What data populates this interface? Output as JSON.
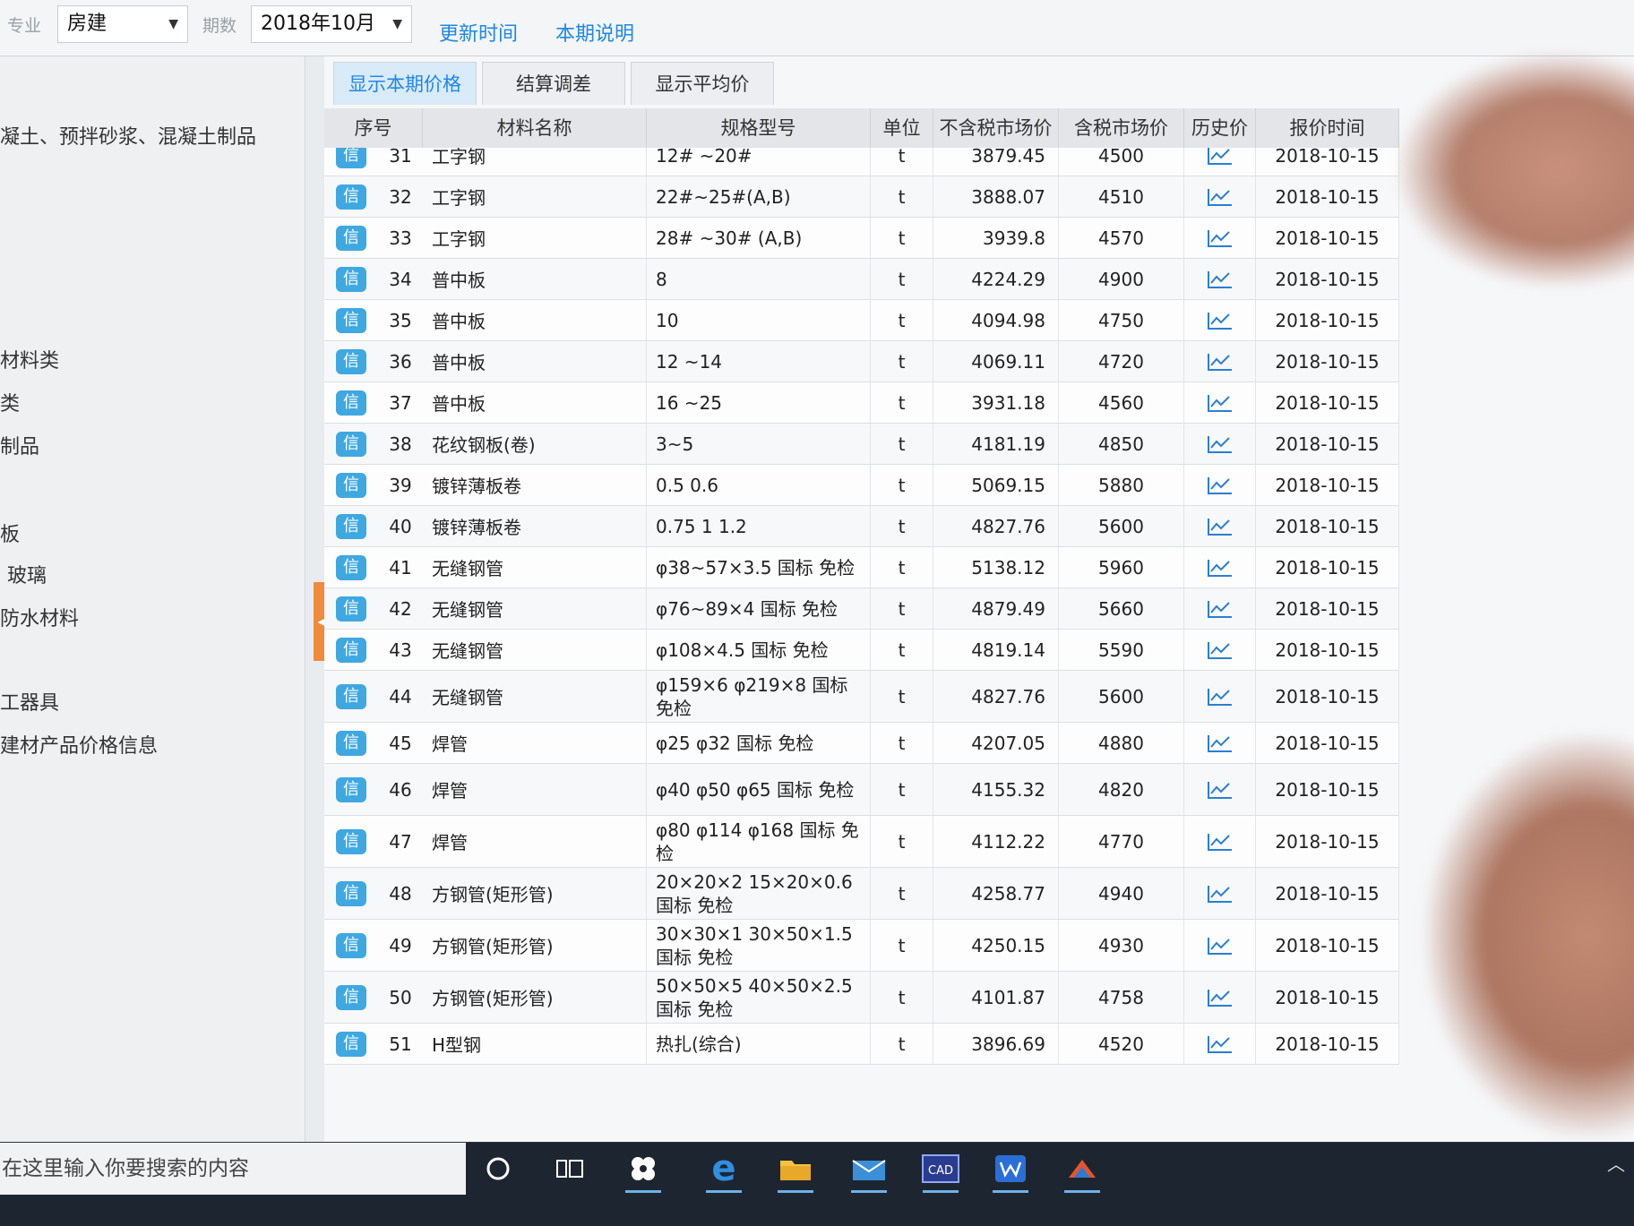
{
  "topbar": {
    "specialty_label": "专业",
    "specialty_value": "房建",
    "period_label": "期数",
    "period_value": "2018年10月",
    "update_time_link": "更新时间",
    "period_note_link": "本期说明"
  },
  "sidebar": {
    "items": [
      {
        "label": "凝土、预拌砂浆、混凝土制品"
      },
      {
        "label": "材料类"
      },
      {
        "label": "类"
      },
      {
        "label": "制品"
      },
      {
        "label": "板"
      },
      {
        "label": "玻璃"
      },
      {
        "label": "防水材料"
      },
      {
        "label": "工器具"
      },
      {
        "label": "建材产品价格信息"
      }
    ]
  },
  "tabs": [
    {
      "label": "显示本期价格"
    },
    {
      "label": "结算调差"
    },
    {
      "label": "显示平均价"
    }
  ],
  "table": {
    "columns": [
      "序号",
      "材料名称",
      "规格型号",
      "单位",
      "不含税市场价",
      "含税市场价",
      "历史价",
      "报价时间"
    ],
    "info_badge": "信",
    "rows": [
      {
        "no": "31",
        "name": "工字钢",
        "spec": "12# ~20#",
        "unit": "t",
        "price_ex": "3879.45",
        "price_in": "4500",
        "date": "2018-10-15"
      },
      {
        "no": "32",
        "name": "工字钢",
        "spec": "22#~25#(A,B)",
        "unit": "t",
        "price_ex": "3888.07",
        "price_in": "4510",
        "date": "2018-10-15"
      },
      {
        "no": "33",
        "name": "工字钢",
        "spec": "28# ~30# (A,B)",
        "unit": "t",
        "price_ex": "3939.8",
        "price_in": "4570",
        "date": "2018-10-15"
      },
      {
        "no": "34",
        "name": "普中板",
        "spec": "8",
        "unit": "t",
        "price_ex": "4224.29",
        "price_in": "4900",
        "date": "2018-10-15"
      },
      {
        "no": "35",
        "name": "普中板",
        "spec": "10",
        "unit": "t",
        "price_ex": "4094.98",
        "price_in": "4750",
        "date": "2018-10-15"
      },
      {
        "no": "36",
        "name": "普中板",
        "spec": "12 ~14",
        "unit": "t",
        "price_ex": "4069.11",
        "price_in": "4720",
        "date": "2018-10-15"
      },
      {
        "no": "37",
        "name": "普中板",
        "spec": "16 ~25",
        "unit": "t",
        "price_ex": "3931.18",
        "price_in": "4560",
        "date": "2018-10-15"
      },
      {
        "no": "38",
        "name": "花纹钢板(卷)",
        "spec": "3~5",
        "unit": "t",
        "price_ex": "4181.19",
        "price_in": "4850",
        "date": "2018-10-15"
      },
      {
        "no": "39",
        "name": "镀锌薄板卷",
        "spec": "0.5 0.6",
        "unit": "t",
        "price_ex": "5069.15",
        "price_in": "5880",
        "date": "2018-10-15"
      },
      {
        "no": "40",
        "name": "镀锌薄板卷",
        "spec": "0.75 1 1.2",
        "unit": "t",
        "price_ex": "4827.76",
        "price_in": "5600",
        "date": "2018-10-15"
      },
      {
        "no": "41",
        "name": "无缝钢管",
        "spec": "φ38~57×3.5 国标 免检",
        "unit": "t",
        "price_ex": "5138.12",
        "price_in": "5960",
        "date": "2018-10-15"
      },
      {
        "no": "42",
        "name": "无缝钢管",
        "spec": "φ76~89×4 国标 免检",
        "unit": "t",
        "price_ex": "4879.49",
        "price_in": "5660",
        "date": "2018-10-15"
      },
      {
        "no": "43",
        "name": "无缝钢管",
        "spec": "φ108×4.5 国标 免检",
        "unit": "t",
        "price_ex": "4819.14",
        "price_in": "5590",
        "date": "2018-10-15"
      },
      {
        "no": "44",
        "name": "无缝钢管",
        "spec": "φ159×6 φ219×8 国标 免检",
        "unit": "t",
        "price_ex": "4827.76",
        "price_in": "5600",
        "date": "2018-10-15"
      },
      {
        "no": "45",
        "name": "焊管",
        "spec": "φ25 φ32 国标 免检",
        "unit": "t",
        "price_ex": "4207.05",
        "price_in": "4880",
        "date": "2018-10-15"
      },
      {
        "no": "46",
        "name": "焊管",
        "spec": "φ40 φ50 φ65 国标 免检",
        "unit": "t",
        "price_ex": "4155.32",
        "price_in": "4820",
        "date": "2018-10-15"
      },
      {
        "no": "47",
        "name": "焊管",
        "spec": "φ80 φ114 φ168 国标 免检",
        "unit": "t",
        "price_ex": "4112.22",
        "price_in": "4770",
        "date": "2018-10-15"
      },
      {
        "no": "48",
        "name": "方钢管(矩形管)",
        "spec": "20×20×2 15×20×0.6 国标 免检",
        "unit": "t",
        "price_ex": "4258.77",
        "price_in": "4940",
        "date": "2018-10-15"
      },
      {
        "no": "49",
        "name": "方钢管(矩形管)",
        "spec": "30×30×1 30×50×1.5 国标 免检",
        "unit": "t",
        "price_ex": "4250.15",
        "price_in": "4930",
        "date": "2018-10-15"
      },
      {
        "no": "50",
        "name": "方钢管(矩形管)",
        "spec": "50×50×5 40×50×2.5 国标 免检",
        "unit": "t",
        "price_ex": "4101.87",
        "price_in": "4758",
        "date": "2018-10-15"
      },
      {
        "no": "51",
        "name": "H型钢",
        "spec": "热扎(综合)",
        "unit": "t",
        "price_ex": "3896.69",
        "price_in": "4520",
        "date": "2018-10-15"
      }
    ]
  },
  "taskbar": {
    "search_placeholder": "在这里输入你要搜索的内容",
    "icons": [
      "cortana-icon",
      "task-view-icon",
      "pinwheel-app-icon",
      "edge-icon",
      "file-explorer-icon",
      "mail-icon",
      "cad-icon",
      "wps-icon",
      "cloud-app-icon"
    ]
  },
  "colors": {
    "accent": "#1e88e5",
    "badge": "#3fa8e0",
    "splitter": "#f08a3c"
  }
}
